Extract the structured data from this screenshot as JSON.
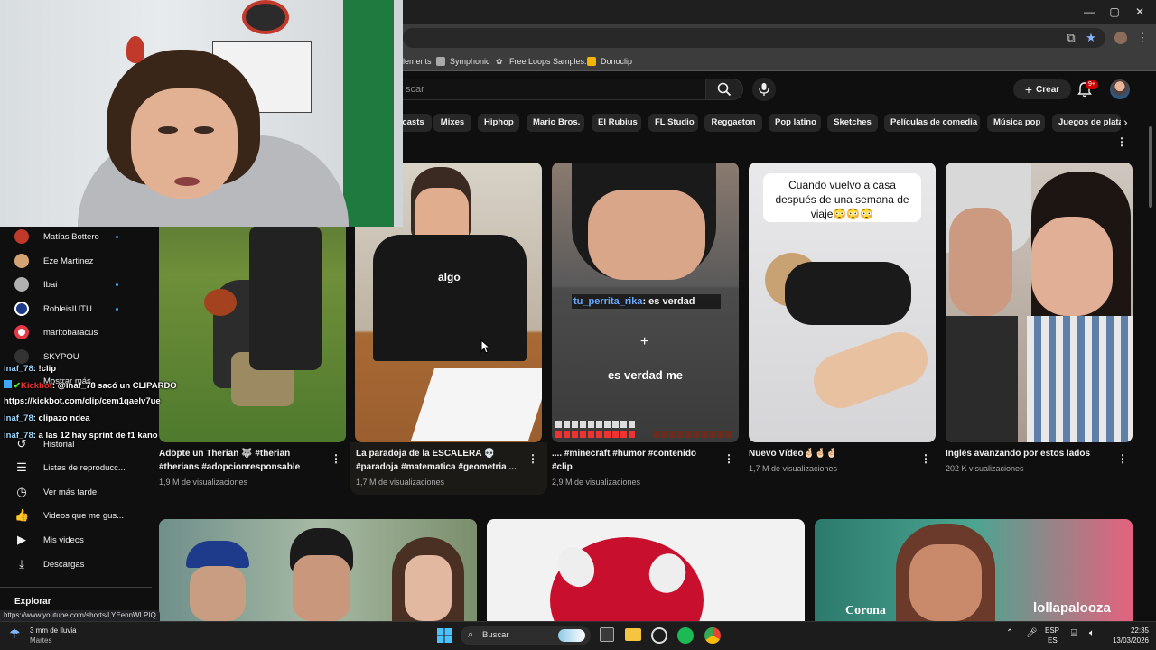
{
  "browser": {
    "bookmarks": [
      {
        "label": "lements",
        "icon": "none"
      },
      {
        "label": "Symphonic",
        "icon": "symphonic-icon"
      },
      {
        "label": "Free Loops Samples...",
        "icon": "freeloops-icon"
      },
      {
        "label": "Donoclip",
        "icon": "donoclip-icon"
      }
    ],
    "status_url": "https://www.youtube.com/shorts/LYEennWLPIQ"
  },
  "header": {
    "search_placeholder": "scar",
    "create_label": "Crear",
    "notification_count": "9+"
  },
  "chips": [
    "casts",
    "Mixes",
    "Hiphop",
    "Mario Bros.",
    "El Rubius",
    "FL Studio",
    "Reggaeton",
    "Pop latino",
    "Sketches",
    "Películas de comedia",
    "Música pop",
    "Juegos de plataf"
  ],
  "sidebar": {
    "subscriptions": [
      {
        "name": "Matías Bottero",
        "live": true,
        "color": "#c0392b"
      },
      {
        "name": "Eze Martinez",
        "live": false,
        "color": "#d4a373"
      },
      {
        "name": "Ibai",
        "live": true,
        "color": "#b0b0b0"
      },
      {
        "name": "RobleisIUTU",
        "live": true,
        "color": "#1e3a8a"
      },
      {
        "name": "maritobaracus",
        "live": false,
        "color": "#e63946"
      },
      {
        "name": "SKYPOU",
        "live": false,
        "color": "#333333"
      }
    ],
    "show_more": "Mostrar más",
    "you_items": [
      {
        "label": "Historial",
        "icon": "history-icon"
      },
      {
        "label": "Listas de reproducc...",
        "icon": "playlist-icon"
      },
      {
        "label": "Ver más tarde",
        "icon": "clock-icon"
      },
      {
        "label": "Videos que me gus...",
        "icon": "like-icon"
      },
      {
        "label": "Mis videos",
        "icon": "video-icon"
      },
      {
        "label": "Descargas",
        "icon": "download-icon"
      }
    ],
    "explore_heading": "Explorar"
  },
  "chat": [
    {
      "user": "inaf_78",
      "text": ": !clip"
    },
    {
      "user": "Kickbot",
      "text": ": @inaf_78 sacó un CLIPARDO"
    },
    {
      "user": "",
      "text": "https://kickbot.com/clip/cem1qaelv7ue"
    },
    {
      "user": "inaf_78",
      "text": ": clipazo ndea"
    },
    {
      "user": "inaf_78",
      "text": ": a las 12 hay sprint de f1 kano"
    }
  ],
  "videos": [
    {
      "title": "Adopte un Therian 🐺 #therian #therians #adopcionresponsable",
      "views": "1,9 M de visualizaciones"
    },
    {
      "title": "La paradoja de la ESCALERA 💀 #paradoja #matematica #geometria ...",
      "views": "1,7 M de visualizaciones"
    },
    {
      "title": ".... #minecraft #humor #contenido #clip",
      "views": "2,9 M de visualizaciones"
    },
    {
      "title": "Nuevo Vídeo🤞🏻🤞🏻🤞🏻",
      "views": "1,7 M de visualizaciones"
    },
    {
      "title": "Inglés avanzando por estos lados",
      "views": "202 K visualizaciones"
    }
  ],
  "thumb_texts": {
    "minecraft_chat_user": "tu_perrita_rika",
    "minecraft_chat_msg": ": es verdad",
    "minecraft_caption": "es verdad me",
    "travel_caption": "Cuando vuelvo a casa después de una semana de viaje😳😳😳",
    "tshirt": "algo",
    "lollapalooza": "lollapalooza",
    "corona": "Corona"
  },
  "taskbar": {
    "weather_temp": "3 mm de lluvia",
    "weather_day": "Martes",
    "search_label": "Buscar",
    "lang_top": "ESP",
    "lang_bottom": "ES",
    "time": "22:35",
    "date": "13/03/2026"
  },
  "colors": {
    "background": "#0f0f0f",
    "chip": "#272727",
    "live_dot": "#3ea6ff",
    "badge": "#cc0000"
  }
}
